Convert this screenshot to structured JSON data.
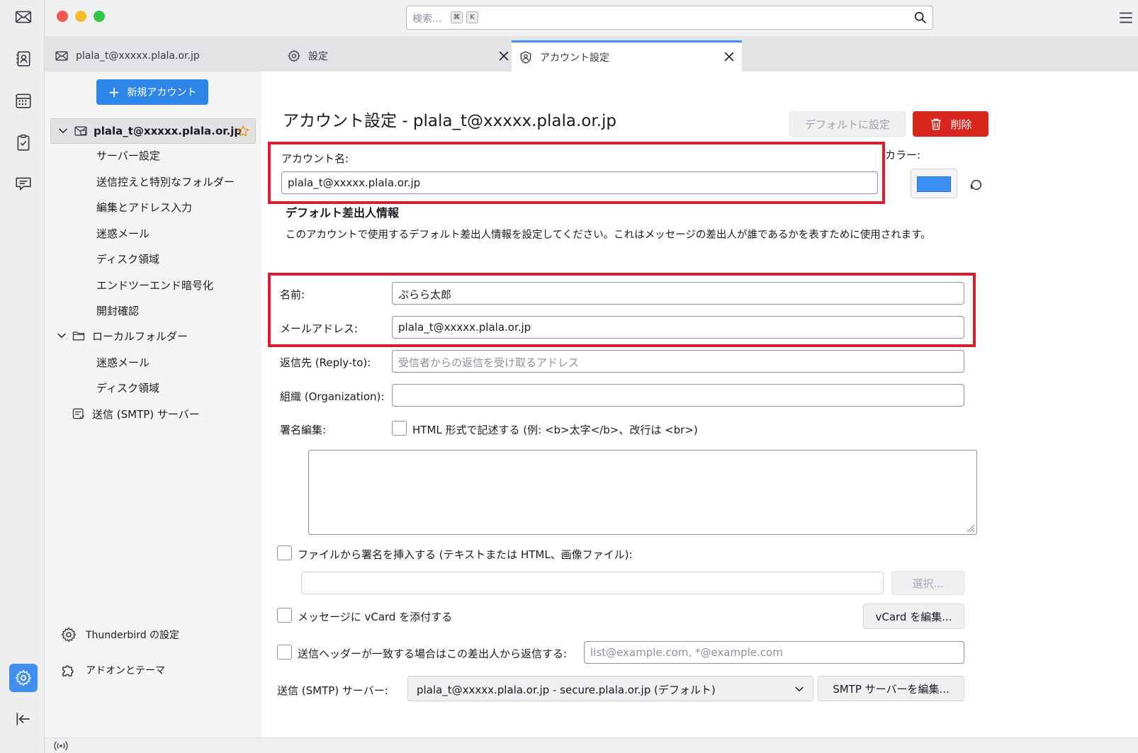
{
  "titlebar": {
    "search_placeholder": "検索...",
    "shortcut_keys": [
      "⌘",
      "K"
    ]
  },
  "tabs": [
    {
      "label": "plala_t@xxxxx.plala.or.jp",
      "icon": "mail-icon",
      "closable": false,
      "selected": false
    },
    {
      "label": "設定",
      "icon": "gear-icon",
      "closable": true,
      "selected": false
    },
    {
      "label": "アカウント設定",
      "icon": "account-icon",
      "closable": true,
      "selected": true
    }
  ],
  "sidebar": {
    "new_account_label": "新規アカウント",
    "account_label": "plala_t@xxxxx.plala.or.jp",
    "account_items": [
      "サーバー設定",
      "送信控えと特別なフォルダー",
      "編集とアドレス入力",
      "迷惑メール",
      "ディスク領域",
      "エンドツーエンド暗号化",
      "開封確認"
    ],
    "local_folders_label": "ローカルフォルダー",
    "local_items": [
      "迷惑メール",
      "ディスク領域"
    ],
    "smtp_label": "送信 (SMTP) サーバー",
    "thunderbird_settings_label": "Thunderbird の設定",
    "addons_label": "アドオンとテーマ"
  },
  "main": {
    "page_title": "アカウント設定 - plala_t@xxxxx.plala.or.jp",
    "set_default_label": "デフォルトに設定",
    "delete_label": "削除",
    "account_name_label": "アカウント名:",
    "account_name_value": "plala_t@xxxxx.plala.or.jp",
    "color_label": "カラー:",
    "color_value": "#3b8ff5",
    "identity_title": "デフォルト差出人情報",
    "identity_desc": "このアカウントで使用するデフォルト差出人情報を設定してください。これはメッセージの差出人が誰であるかを表すために使用されます。",
    "name_label": "名前:",
    "name_value": "ぷらら太郎",
    "email_label": "メールアドレス:",
    "email_value": "plala_t@xxxxx.plala.or.jp",
    "replyto_label": "返信先 (Reply-to):",
    "replyto_placeholder": "受信者からの返信を受け取るアドレス",
    "org_label": "組織 (Organization):",
    "org_value": "",
    "signature_label": "署名編集:",
    "html_checkbox_label": "HTML 形式で記述する (例: <b>太字</b>、改行は <br>)",
    "sig_file_label": "ファイルから署名を挿入する (テキストまたは HTML、画像ファイル):",
    "choose_label": "選択...",
    "vcard_label": "メッセージに vCard を添付する",
    "vcard_edit_label": "vCard を編集...",
    "reply_header_label": "送信ヘッダーが一致する場合はこの差出人から返信する:",
    "reply_header_placeholder": "list@example.com, *@example.com",
    "smtp_label": "送信 (SMTP) サーバー:",
    "smtp_value": "plala_t@xxxxx.plala.or.jp - secure.plala.or.jp (デフォルト)",
    "smtp_edit_label": "SMTP サーバーを編集..."
  },
  "colors": {
    "accent": "#3f8ef0",
    "delete": "#d7271f",
    "highlight": "#d42030"
  }
}
